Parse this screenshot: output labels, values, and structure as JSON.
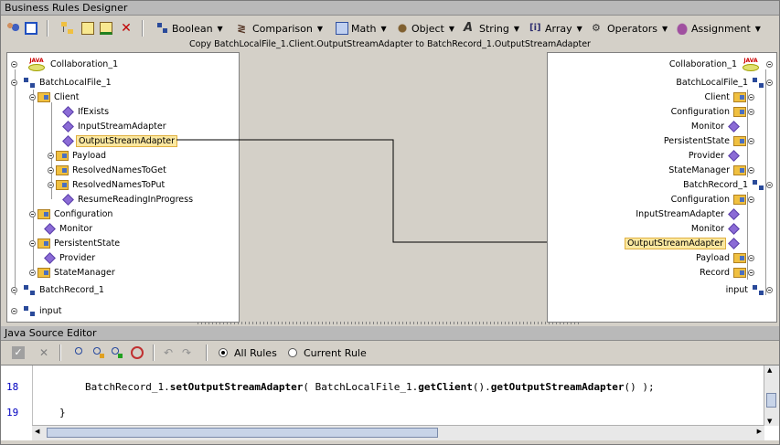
{
  "brd": {
    "title": "Business Rules Designer",
    "toolbar": {
      "boolean": "Boolean",
      "comparison": "Comparison",
      "math": "Math",
      "object": "Object",
      "string": "String",
      "array": "Array",
      "operators": "Operators",
      "assignment": "Assignment"
    },
    "rule_description": "Copy BatchLocalFile_1.Client.OutputStreamAdapter to BatchRecord_1.OutputStreamAdapter"
  },
  "left_tree": {
    "collaboration": "Collaboration_1",
    "batchlocalfile": "BatchLocalFile_1",
    "client": "Client",
    "ifexists": "IfExists",
    "inputstreamadapter": "InputStreamAdapter",
    "outputstreamadapter": "OutputStreamAdapter",
    "payload": "Payload",
    "resolvednamestoget": "ResolvedNamesToGet",
    "resolvednamestoput": "ResolvedNamesToPut",
    "resumereading": "ResumeReadingInProgress",
    "configuration": "Configuration",
    "monitor": "Monitor",
    "persistentstate": "PersistentState",
    "provider": "Provider",
    "statemanager": "StateManager",
    "batchrecord": "BatchRecord_1",
    "input": "input"
  },
  "right_tree": {
    "collaboration": "Collaboration_1",
    "batchlocalfile": "BatchLocalFile_1",
    "client": "Client",
    "configuration": "Configuration",
    "monitor": "Monitor",
    "persistentstate": "PersistentState",
    "provider": "Provider",
    "statemanager": "StateManager",
    "batchrecord": "BatchRecord_1",
    "br_configuration": "Configuration",
    "br_inputstreamadapter": "InputStreamAdapter",
    "br_monitor": "Monitor",
    "br_outputstreamadapter": "OutputStreamAdapter",
    "br_payload": "Payload",
    "br_record": "Record",
    "input": "input"
  },
  "editor": {
    "title": "Java Source Editor",
    "all_rules": "All Rules",
    "current_rule": "Current Rule",
    "lines": [
      {
        "num": "18",
        "pre": "BatchRecord_1.",
        "m1": "setOutputStreamAdapter",
        "mid": "( BatchLocalFile_1.",
        "m2": "getClient",
        "mid2": "().",
        "m3": "getOutputStreamAdapter",
        "post": "() );"
      },
      {
        "num": "19",
        "text": "}"
      }
    ]
  },
  "colors": {
    "selected_bg": "#fbe8a0",
    "diamond": "#8b6bd6",
    "folder": "#f0c040"
  }
}
